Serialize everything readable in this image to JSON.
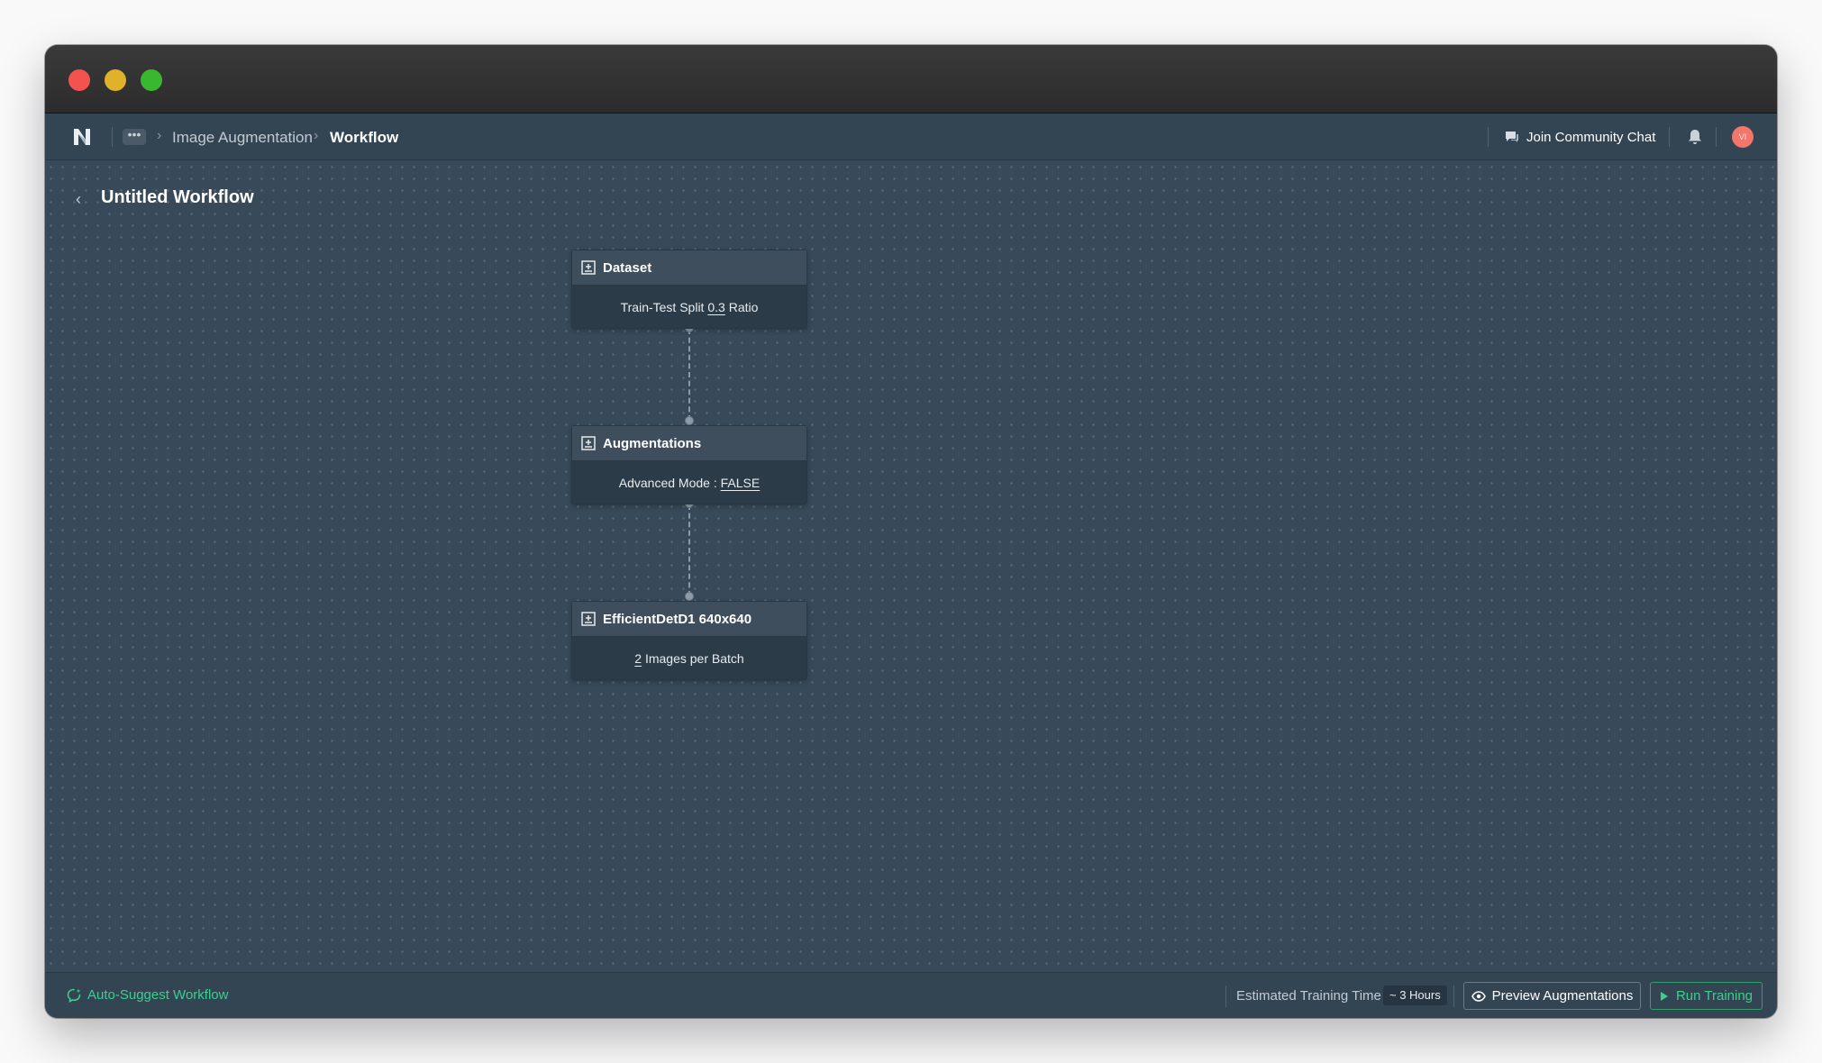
{
  "window": {
    "controls": [
      "close",
      "minimize",
      "maximize"
    ]
  },
  "navbar": {
    "logo": "N",
    "more_label": "•••",
    "breadcrumbs": [
      "Image Augmentation",
      "Workflow"
    ],
    "community_label": "Join Community Chat",
    "avatar_initials": "VI"
  },
  "workflow": {
    "back_label": "‹",
    "title": "Untitled Workflow",
    "nodes": [
      {
        "title": "Dataset",
        "body_prefix": "Train-Test Split ",
        "body_value": "0.3",
        "body_suffix": " Ratio"
      },
      {
        "title": "Augmentations",
        "body_prefix": "Advanced Mode : ",
        "body_value": "FALSE",
        "body_suffix": ""
      },
      {
        "title": "EfficientDetD1 640x640",
        "body_prefix": "",
        "body_value": "2",
        "body_suffix": " Images per Batch"
      }
    ]
  },
  "footer": {
    "auto_suggest_label": "Auto-Suggest Workflow",
    "estimated_label": "Estimated Training Time",
    "estimated_value": "~ 3 Hours",
    "preview_label": "Preview Augmentations",
    "run_label": "Run Training"
  },
  "colors": {
    "canvas": "#384a5a",
    "accent_green": "#3ccf8e",
    "node_header": "#3e4e5d",
    "node_body": "#2c3b48"
  }
}
